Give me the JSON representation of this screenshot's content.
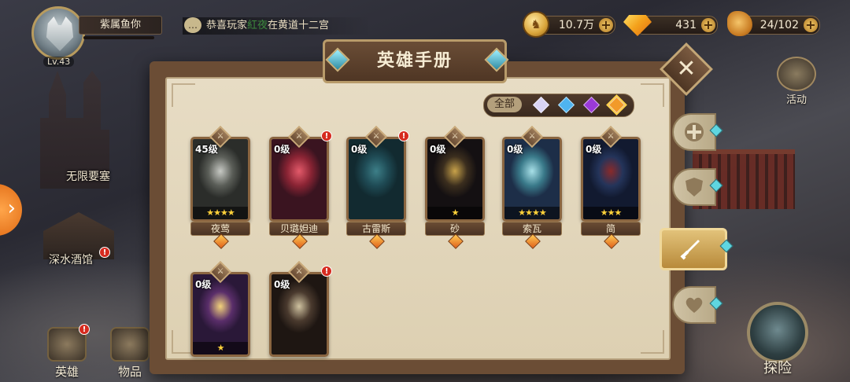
{
  "player": {
    "name": "紫属鱼你",
    "level": "Lv.43"
  },
  "chat": {
    "prefix": "恭喜玩家",
    "highlight": "紅夜",
    "suffix": "在黄道十二宫"
  },
  "resources": {
    "gold": "10.7万",
    "gems": "431",
    "stamina": "24/102"
  },
  "map": {
    "labels": [
      "无限要塞",
      "深水酒馆"
    ],
    "activity": "活动"
  },
  "nav": {
    "heroes": "英雄",
    "items": "物品",
    "explore": "探险"
  },
  "panel": {
    "title": "英雄手册",
    "filter_all": "全部"
  },
  "heroes": [
    {
      "name": "夜莺",
      "level": "45级",
      "stars": "★★★★",
      "alert": false,
      "colors": [
        "#c7c9c4",
        "#5b5e58",
        "#2b2d2a"
      ]
    },
    {
      "name": "贝璐妲迪",
      "level": "0级",
      "stars": "",
      "alert": true,
      "colors": [
        "#e35a6a",
        "#8a2434",
        "#3a1420"
      ]
    },
    {
      "name": "古雷斯",
      "level": "0级",
      "stars": "",
      "alert": true,
      "colors": [
        "#3d7f88",
        "#1f4b55",
        "#122a30"
      ]
    },
    {
      "name": "砂",
      "level": "0级",
      "stars": "★",
      "alert": false,
      "colors": [
        "#c8a24a",
        "#3b2e1e",
        "#141012"
      ]
    },
    {
      "name": "索瓦",
      "level": "0级",
      "stars": "★★★★",
      "alert": false,
      "colors": [
        "#a8e0e8",
        "#3a7a8a",
        "#1d2e48"
      ]
    },
    {
      "name": "简",
      "level": "0级",
      "stars": "★★★",
      "alert": false,
      "colors": [
        "#8a2a2a",
        "#24345a",
        "#121a30"
      ]
    },
    {
      "name": "",
      "level": "0级",
      "stars": "★",
      "alert": false,
      "colors": [
        "#f3d37a",
        "#5a2e6a",
        "#2a1838"
      ]
    },
    {
      "name": "",
      "level": "0级",
      "stars": "",
      "alert": true,
      "colors": [
        "#cfc2a0",
        "#4a3a2e",
        "#1e1612"
      ]
    }
  ],
  "filter_gems": [
    {
      "name": "white-gem-icon",
      "color": "#d9d4f5"
    },
    {
      "name": "blue-gem-icon",
      "color": "#4fb4f0"
    },
    {
      "name": "purple-gem-icon",
      "color": "#9a3ad8"
    },
    {
      "name": "orange-gem-icon",
      "color": "#f29a2a"
    }
  ],
  "side_tabs": [
    "plus-icon",
    "shield-icon",
    "sword-icon",
    "heart-icon"
  ],
  "alert_mark": "!"
}
